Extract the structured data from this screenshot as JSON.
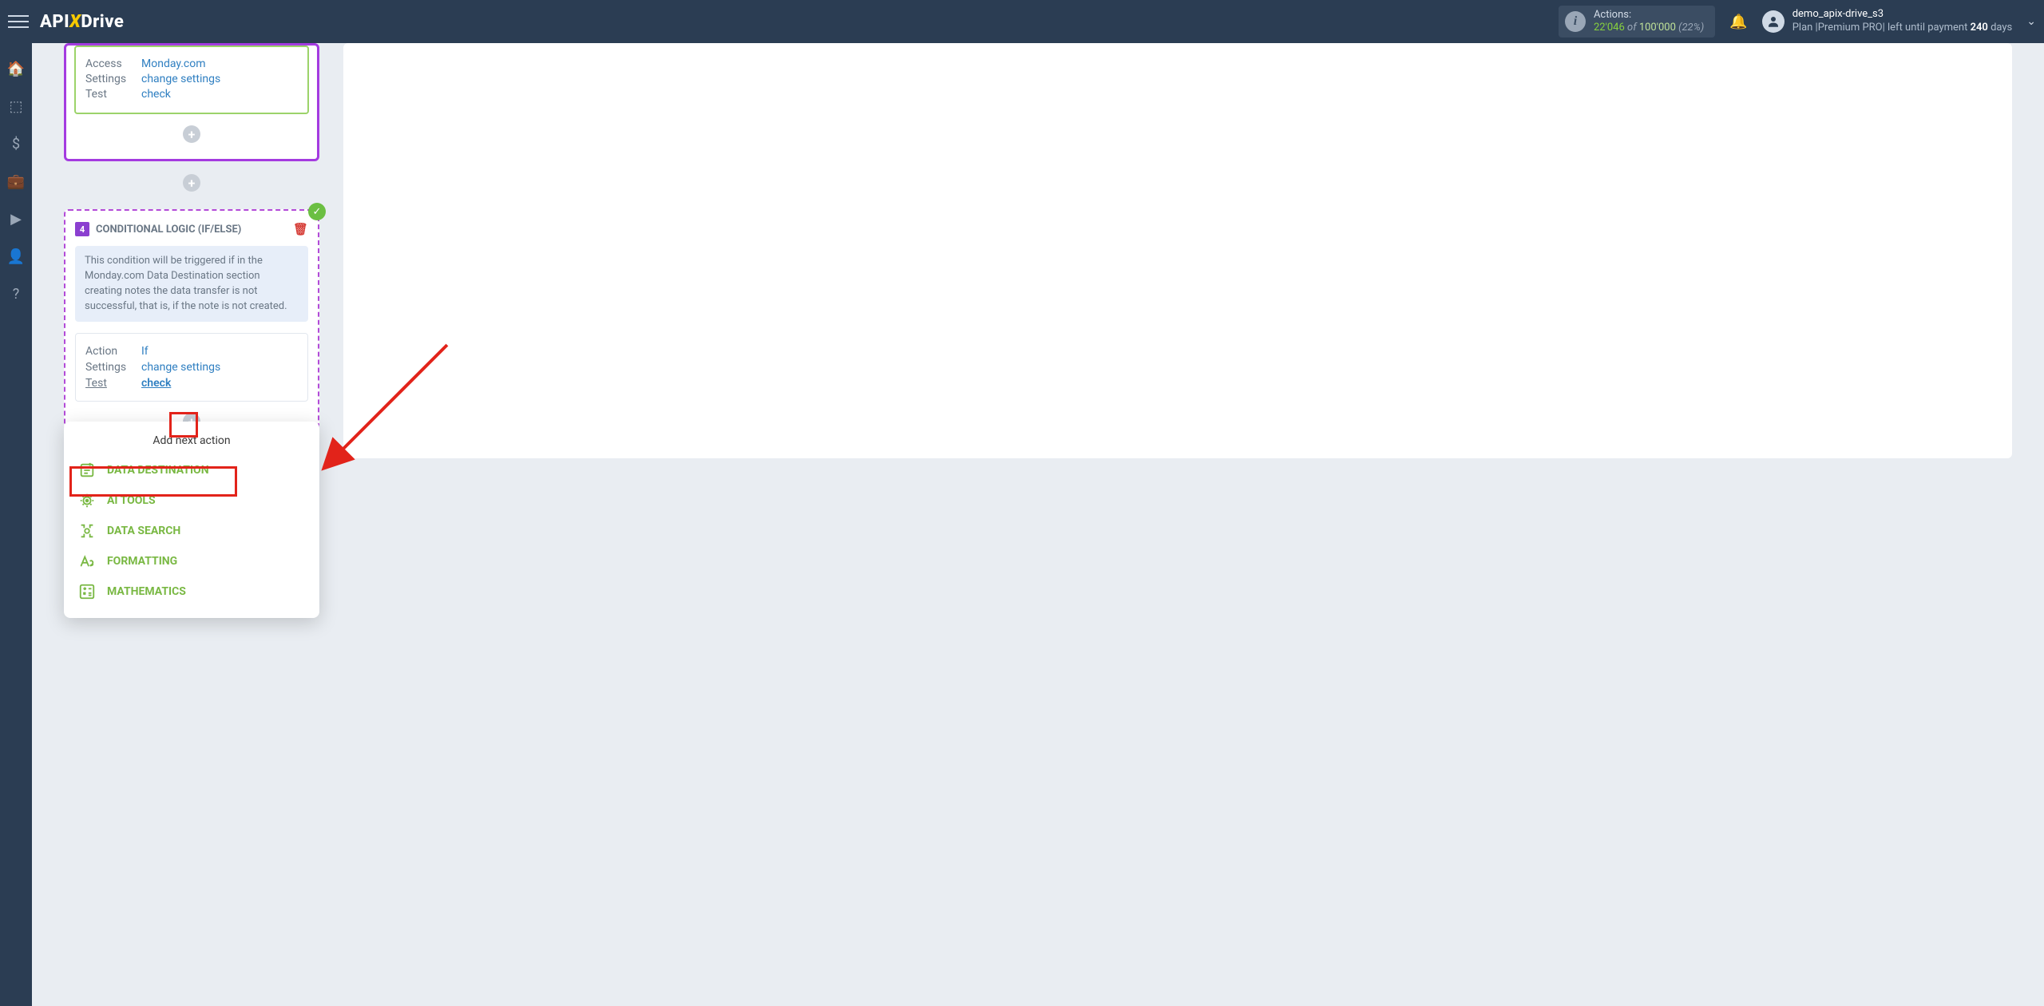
{
  "topbar": {
    "actions": {
      "label": "Actions:",
      "used": "22'046",
      "of": "of",
      "total": "100'000",
      "pct": "(22%)"
    },
    "user": {
      "name": "demo_apix-drive_s3",
      "plan_prefix": "Plan |Premium PRO| left until payment ",
      "days": "240",
      "plan_suffix": " days"
    }
  },
  "source_card": {
    "rows": [
      {
        "k": "Access",
        "v": "Monday.com"
      },
      {
        "k": "Settings",
        "v": "change settings"
      },
      {
        "k": "Test",
        "v": "check"
      }
    ]
  },
  "cond_card": {
    "num": "4",
    "title": "CONDITIONAL LOGIC (IF/ELSE)",
    "desc": "This condition will be triggered if in the Monday.com Data Destination section creating notes the data transfer is not successful, that is, if the note is not created.",
    "rows": [
      {
        "k": "Action",
        "v": "If",
        "ku": false,
        "vu": false
      },
      {
        "k": "Settings",
        "v": "change settings",
        "ku": false,
        "vu": false
      },
      {
        "k": "Test",
        "v": "check",
        "ku": true,
        "vu": true
      }
    ]
  },
  "popup": {
    "title": "Add next action",
    "items": [
      "DATA DESTINATION",
      "AI TOOLS",
      "DATA SEARCH",
      "FORMATTING",
      "MATHEMATICS"
    ]
  }
}
